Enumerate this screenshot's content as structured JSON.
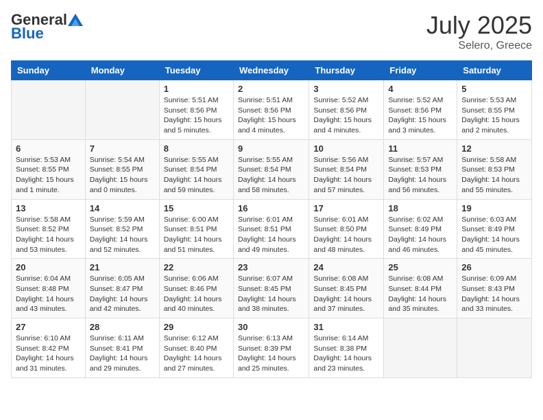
{
  "header": {
    "logo_general": "General",
    "logo_blue": "Blue",
    "month_year": "July 2025",
    "location": "Selero, Greece"
  },
  "days_of_week": [
    "Sunday",
    "Monday",
    "Tuesday",
    "Wednesday",
    "Thursday",
    "Friday",
    "Saturday"
  ],
  "weeks": [
    [
      {
        "day": "",
        "empty": true
      },
      {
        "day": "",
        "empty": true
      },
      {
        "day": "1",
        "sunrise": "Sunrise: 5:51 AM",
        "sunset": "Sunset: 8:56 PM",
        "daylight": "Daylight: 15 hours and 5 minutes."
      },
      {
        "day": "2",
        "sunrise": "Sunrise: 5:51 AM",
        "sunset": "Sunset: 8:56 PM",
        "daylight": "Daylight: 15 hours and 4 minutes."
      },
      {
        "day": "3",
        "sunrise": "Sunrise: 5:52 AM",
        "sunset": "Sunset: 8:56 PM",
        "daylight": "Daylight: 15 hours and 4 minutes."
      },
      {
        "day": "4",
        "sunrise": "Sunrise: 5:52 AM",
        "sunset": "Sunset: 8:56 PM",
        "daylight": "Daylight: 15 hours and 3 minutes."
      },
      {
        "day": "5",
        "sunrise": "Sunrise: 5:53 AM",
        "sunset": "Sunset: 8:55 PM",
        "daylight": "Daylight: 15 hours and 2 minutes."
      }
    ],
    [
      {
        "day": "6",
        "sunrise": "Sunrise: 5:53 AM",
        "sunset": "Sunset: 8:55 PM",
        "daylight": "Daylight: 15 hours and 1 minute."
      },
      {
        "day": "7",
        "sunrise": "Sunrise: 5:54 AM",
        "sunset": "Sunset: 8:55 PM",
        "daylight": "Daylight: 15 hours and 0 minutes."
      },
      {
        "day": "8",
        "sunrise": "Sunrise: 5:55 AM",
        "sunset": "Sunset: 8:54 PM",
        "daylight": "Daylight: 14 hours and 59 minutes."
      },
      {
        "day": "9",
        "sunrise": "Sunrise: 5:55 AM",
        "sunset": "Sunset: 8:54 PM",
        "daylight": "Daylight: 14 hours and 58 minutes."
      },
      {
        "day": "10",
        "sunrise": "Sunrise: 5:56 AM",
        "sunset": "Sunset: 8:54 PM",
        "daylight": "Daylight: 14 hours and 57 minutes."
      },
      {
        "day": "11",
        "sunrise": "Sunrise: 5:57 AM",
        "sunset": "Sunset: 8:53 PM",
        "daylight": "Daylight: 14 hours and 56 minutes."
      },
      {
        "day": "12",
        "sunrise": "Sunrise: 5:58 AM",
        "sunset": "Sunset: 8:53 PM",
        "daylight": "Daylight: 14 hours and 55 minutes."
      }
    ],
    [
      {
        "day": "13",
        "sunrise": "Sunrise: 5:58 AM",
        "sunset": "Sunset: 8:52 PM",
        "daylight": "Daylight: 14 hours and 53 minutes."
      },
      {
        "day": "14",
        "sunrise": "Sunrise: 5:59 AM",
        "sunset": "Sunset: 8:52 PM",
        "daylight": "Daylight: 14 hours and 52 minutes."
      },
      {
        "day": "15",
        "sunrise": "Sunrise: 6:00 AM",
        "sunset": "Sunset: 8:51 PM",
        "daylight": "Daylight: 14 hours and 51 minutes."
      },
      {
        "day": "16",
        "sunrise": "Sunrise: 6:01 AM",
        "sunset": "Sunset: 8:51 PM",
        "daylight": "Daylight: 14 hours and 49 minutes."
      },
      {
        "day": "17",
        "sunrise": "Sunrise: 6:01 AM",
        "sunset": "Sunset: 8:50 PM",
        "daylight": "Daylight: 14 hours and 48 minutes."
      },
      {
        "day": "18",
        "sunrise": "Sunrise: 6:02 AM",
        "sunset": "Sunset: 8:49 PM",
        "daylight": "Daylight: 14 hours and 46 minutes."
      },
      {
        "day": "19",
        "sunrise": "Sunrise: 6:03 AM",
        "sunset": "Sunset: 8:49 PM",
        "daylight": "Daylight: 14 hours and 45 minutes."
      }
    ],
    [
      {
        "day": "20",
        "sunrise": "Sunrise: 6:04 AM",
        "sunset": "Sunset: 8:48 PM",
        "daylight": "Daylight: 14 hours and 43 minutes."
      },
      {
        "day": "21",
        "sunrise": "Sunrise: 6:05 AM",
        "sunset": "Sunset: 8:47 PM",
        "daylight": "Daylight: 14 hours and 42 minutes."
      },
      {
        "day": "22",
        "sunrise": "Sunrise: 6:06 AM",
        "sunset": "Sunset: 8:46 PM",
        "daylight": "Daylight: 14 hours and 40 minutes."
      },
      {
        "day": "23",
        "sunrise": "Sunrise: 6:07 AM",
        "sunset": "Sunset: 8:45 PM",
        "daylight": "Daylight: 14 hours and 38 minutes."
      },
      {
        "day": "24",
        "sunrise": "Sunrise: 6:08 AM",
        "sunset": "Sunset: 8:45 PM",
        "daylight": "Daylight: 14 hours and 37 minutes."
      },
      {
        "day": "25",
        "sunrise": "Sunrise: 6:08 AM",
        "sunset": "Sunset: 8:44 PM",
        "daylight": "Daylight: 14 hours and 35 minutes."
      },
      {
        "day": "26",
        "sunrise": "Sunrise: 6:09 AM",
        "sunset": "Sunset: 8:43 PM",
        "daylight": "Daylight: 14 hours and 33 minutes."
      }
    ],
    [
      {
        "day": "27",
        "sunrise": "Sunrise: 6:10 AM",
        "sunset": "Sunset: 8:42 PM",
        "daylight": "Daylight: 14 hours and 31 minutes."
      },
      {
        "day": "28",
        "sunrise": "Sunrise: 6:11 AM",
        "sunset": "Sunset: 8:41 PM",
        "daylight": "Daylight: 14 hours and 29 minutes."
      },
      {
        "day": "29",
        "sunrise": "Sunrise: 6:12 AM",
        "sunset": "Sunset: 8:40 PM",
        "daylight": "Daylight: 14 hours and 27 minutes."
      },
      {
        "day": "30",
        "sunrise": "Sunrise: 6:13 AM",
        "sunset": "Sunset: 8:39 PM",
        "daylight": "Daylight: 14 hours and 25 minutes."
      },
      {
        "day": "31",
        "sunrise": "Sunrise: 6:14 AM",
        "sunset": "Sunset: 8:38 PM",
        "daylight": "Daylight: 14 hours and 23 minutes."
      },
      {
        "day": "",
        "empty": true
      },
      {
        "day": "",
        "empty": true
      }
    ]
  ]
}
